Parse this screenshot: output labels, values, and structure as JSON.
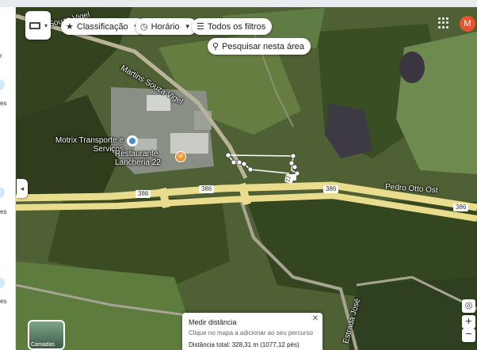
{
  "toolbar": {
    "chips": [
      {
        "label": "Classificação",
        "icon": "star-icon",
        "has_caret": true
      },
      {
        "label": "Horário",
        "icon": "clock-icon",
        "has_caret": true
      },
      {
        "label": "Todos os filtros",
        "icon": "sliders-icon",
        "has_caret": false
      }
    ],
    "search_area": "Pesquisar nesta área",
    "avatar_initial": "M"
  },
  "map": {
    "labels": {
      "road_top": "Rua Souza Vigel",
      "road_mid": "Martins Souza Vigel",
      "business": "Motrix Transporte e Serviços",
      "restaurant": "Restaurante Lancheria 22",
      "highway": "Pedro Otto Ost",
      "road_bottom": "Estrada José"
    },
    "route_shields": [
      "386",
      "386",
      "386",
      "386"
    ],
    "path_label": "22",
    "thumb_label": "Camadas"
  },
  "measure": {
    "title": "Medir distância",
    "hint": "Clique no mapa a adicionar ao seu percurso",
    "total": "Distância total: 328,31 m (1077,12 pés)"
  },
  "left_panel": {
    "fragments": [
      "r",
      "es",
      "es",
      "es"
    ]
  },
  "colors": {
    "highway": "#e9dc8c",
    "measure_line": "#ffffff",
    "avatar": "#e8542b"
  }
}
